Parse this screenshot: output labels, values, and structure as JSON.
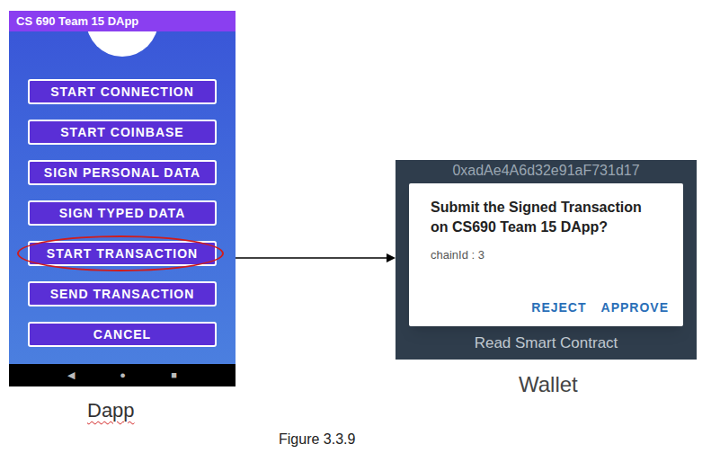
{
  "figure": {
    "caption": "Figure 3.3.9"
  },
  "dapp": {
    "title": "CS 690 Team 15 DApp",
    "caption": "Dapp",
    "buttons": [
      {
        "label": "START CONNECTION",
        "highlighted": false
      },
      {
        "label": "START COINBASE",
        "highlighted": false
      },
      {
        "label": "SIGN PERSONAL DATA",
        "highlighted": false
      },
      {
        "label": "SIGN TYPED DATA",
        "highlighted": false
      },
      {
        "label": "START TRANSACTION",
        "highlighted": true
      },
      {
        "label": "SEND TRANSACTION",
        "highlighted": false
      },
      {
        "label": "CANCEL",
        "highlighted": false
      }
    ],
    "nav": [
      "◀",
      "●",
      "■"
    ]
  },
  "wallet": {
    "caption": "Wallet",
    "address": "0xadAe4A6d32e91aF731d17",
    "dialog": {
      "title": "Submit the Signed Transaction on CS690 Team 15 DApp?",
      "body": "chainId : 3",
      "buttons": [
        "REJECT",
        "APPROVE"
      ]
    },
    "background_button": "Read Smart Contract"
  }
}
